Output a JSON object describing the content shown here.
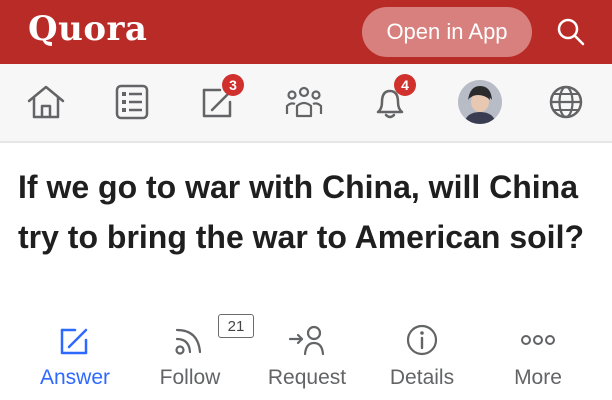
{
  "header": {
    "logo": "Quora",
    "open_app_label": "Open in App",
    "search_icon": "search-icon"
  },
  "nav": {
    "items": [
      {
        "icon": "home-icon"
      },
      {
        "icon": "answers-list-icon"
      },
      {
        "icon": "write-icon",
        "badge": "3"
      },
      {
        "icon": "spaces-icon"
      },
      {
        "icon": "bell-icon",
        "badge": "4"
      },
      {
        "icon": "avatar"
      },
      {
        "icon": "globe-icon"
      }
    ]
  },
  "question": {
    "title": "If we go to war with China, will China try to bring the war to American soil?"
  },
  "actions": {
    "answer": "Answer",
    "follow": "Follow",
    "follow_count": "21",
    "request": "Request",
    "details": "Details",
    "more": "More"
  },
  "colors": {
    "brand": "#b92b27",
    "accent": "#2e69ff",
    "badge": "#d0312d"
  }
}
